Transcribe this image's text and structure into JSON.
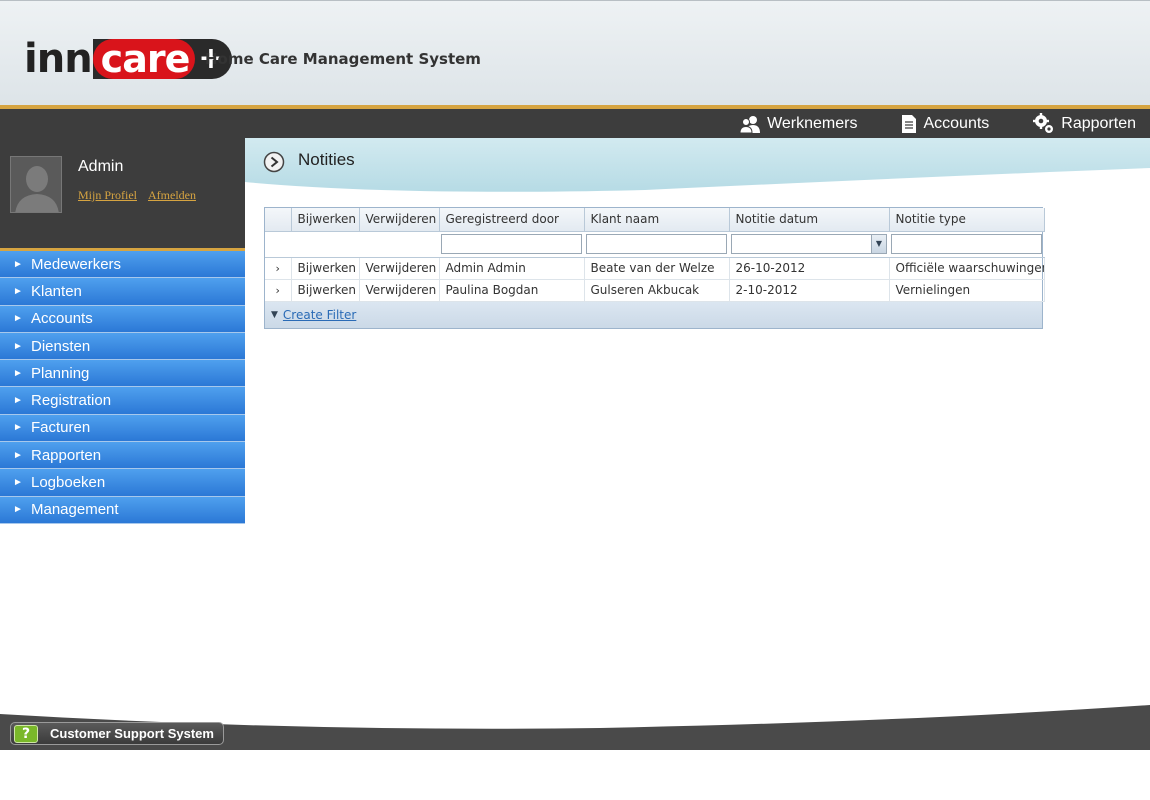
{
  "header": {
    "logo_left": "inn",
    "logo_mid": "care",
    "logo_plus": "+",
    "app_title": "Home Care Management System"
  },
  "topnav": {
    "items": [
      {
        "label": "Werknemers",
        "icon": "users-icon"
      },
      {
        "label": "Accounts",
        "icon": "document-icon"
      },
      {
        "label": "Rapporten",
        "icon": "gears-icon"
      }
    ]
  },
  "user": {
    "name": "Admin",
    "profile_link": "Mijn Profiel",
    "logout_link": "Afmelden"
  },
  "sidebar": {
    "items": [
      {
        "label": "Medewerkers"
      },
      {
        "label": "Klanten"
      },
      {
        "label": "Accounts"
      },
      {
        "label": "Diensten"
      },
      {
        "label": "Planning"
      },
      {
        "label": "Registration"
      },
      {
        "label": "Facturen"
      },
      {
        "label": "Rapporten"
      },
      {
        "label": "Logboeken"
      },
      {
        "label": "Management"
      }
    ]
  },
  "page": {
    "title": "Notities"
  },
  "grid": {
    "columns": [
      "Bijwerken",
      "Verwijderen",
      "Geregistreerd door",
      "Klant naam",
      "Notitie datum",
      "Notitie type"
    ],
    "rows": [
      {
        "edit": "Bijwerken",
        "delete": "Verwijderen",
        "registered_by": "Admin Admin",
        "client": "Beate van der Welze",
        "date": "26-10-2012",
        "type": "Officiële waarschuwingen"
      },
      {
        "edit": "Bijwerken",
        "delete": "Verwijderen",
        "registered_by": "Paulina Bogdan",
        "client": "Gulseren Akbucak",
        "date": "2-10-2012",
        "type": "Vernielingen"
      }
    ],
    "footer_link": "Create Filter"
  },
  "footer": {
    "support_label": "Customer Support System"
  },
  "colors": {
    "accent_gold": "#d6a441",
    "nav_blue": "#2b78d6",
    "dark_bar": "#3d3d3d",
    "logo_red": "#d9141b"
  }
}
